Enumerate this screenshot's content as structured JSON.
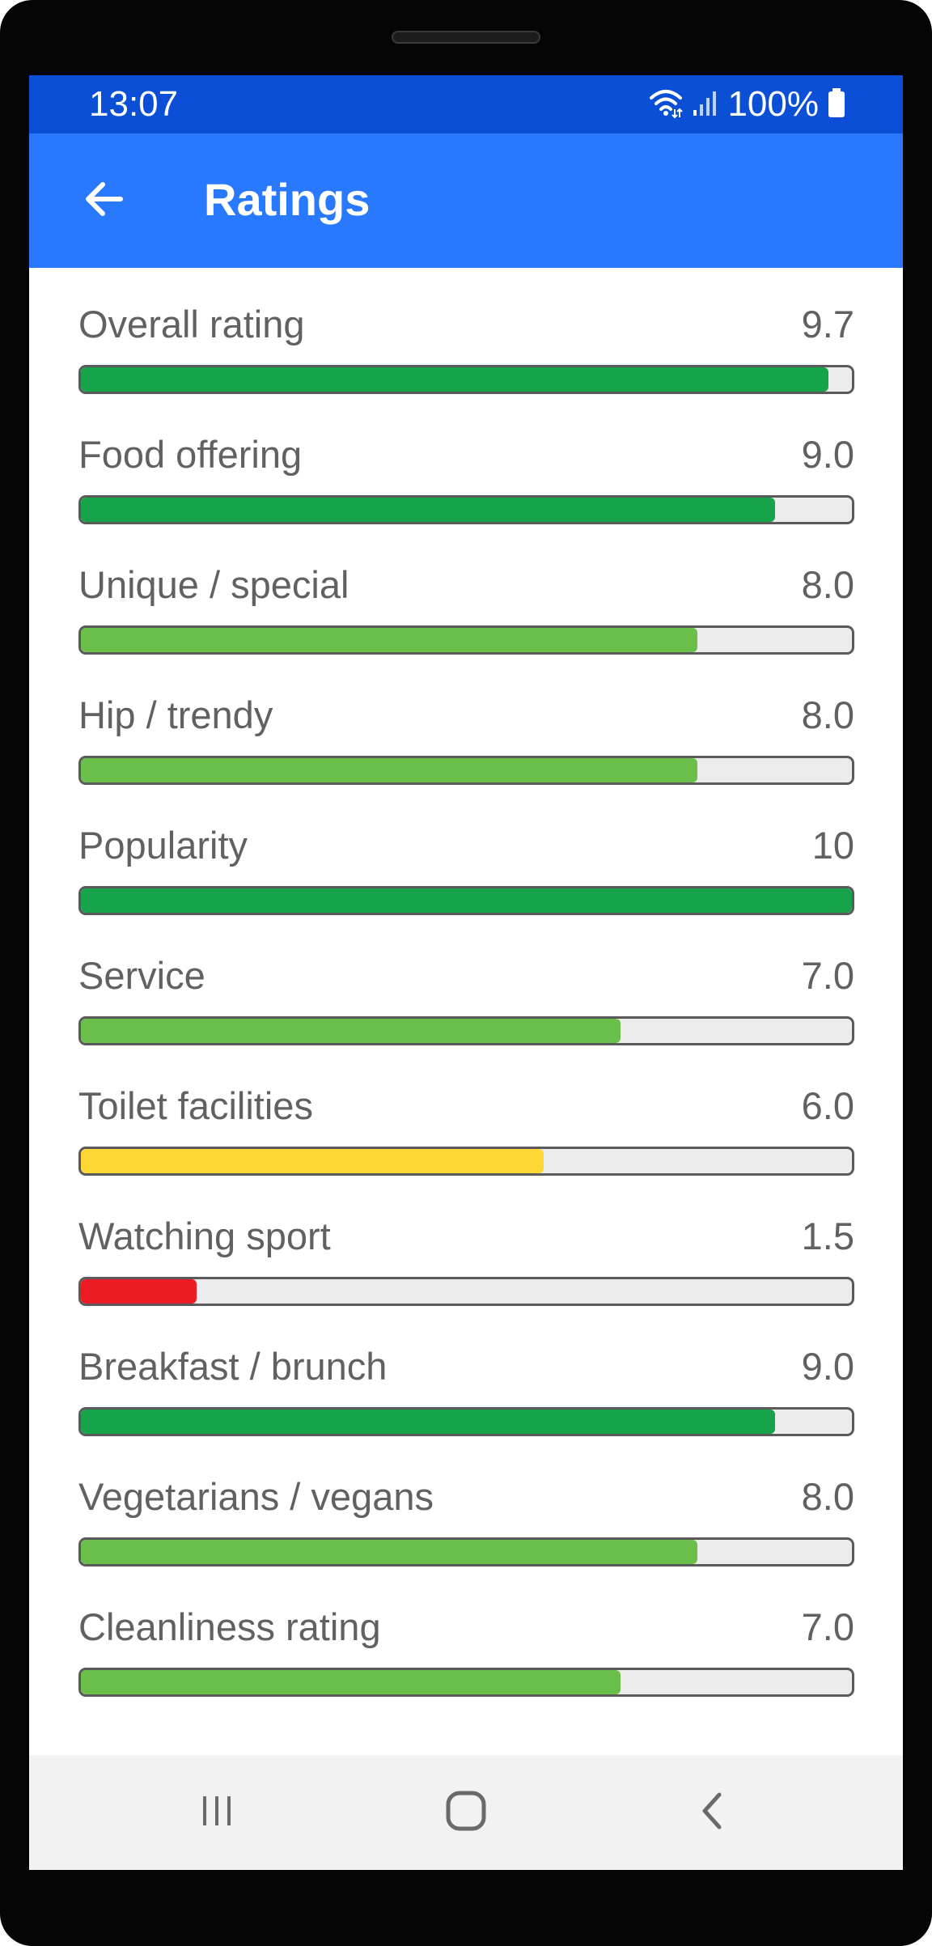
{
  "status_bar": {
    "time": "13:07",
    "battery": "100%",
    "icons": [
      "wifi-icon",
      "signal-icon",
      "battery-icon"
    ]
  },
  "app_bar": {
    "title": "Ratings",
    "back_icon": "arrow-left-icon",
    "color": "#2979ff"
  },
  "colors": {
    "excellent": "#16a34a",
    "good": "#6abf4b",
    "average": "#fdd835",
    "poor": "#ed1c24",
    "track": "#ececec"
  },
  "ratings": [
    {
      "label": "Overall rating",
      "value": "9.7",
      "score": 9.7,
      "level": "excellent"
    },
    {
      "label": "Food offering",
      "value": "9.0",
      "score": 9.0,
      "level": "excellent"
    },
    {
      "label": "Unique / special",
      "value": "8.0",
      "score": 8.0,
      "level": "good"
    },
    {
      "label": "Hip / trendy",
      "value": "8.0",
      "score": 8.0,
      "level": "good"
    },
    {
      "label": "Popularity",
      "value": "10",
      "score": 10,
      "level": "excellent"
    },
    {
      "label": "Service",
      "value": "7.0",
      "score": 7.0,
      "level": "good"
    },
    {
      "label": "Toilet facilities",
      "value": "6.0",
      "score": 6.0,
      "level": "average"
    },
    {
      "label": "Watching sport",
      "value": "1.5",
      "score": 1.5,
      "level": "poor"
    },
    {
      "label": "Breakfast / brunch",
      "value": "9.0",
      "score": 9.0,
      "level": "excellent"
    },
    {
      "label": "Vegetarians / vegans",
      "value": "8.0",
      "score": 8.0,
      "level": "good"
    },
    {
      "label": "Cleanliness rating",
      "value": "7.0",
      "score": 7.0,
      "level": "good"
    }
  ],
  "scale_max": 10,
  "nav_bar": {
    "buttons": [
      "recent-apps-icon",
      "home-icon",
      "back-nav-icon"
    ]
  }
}
